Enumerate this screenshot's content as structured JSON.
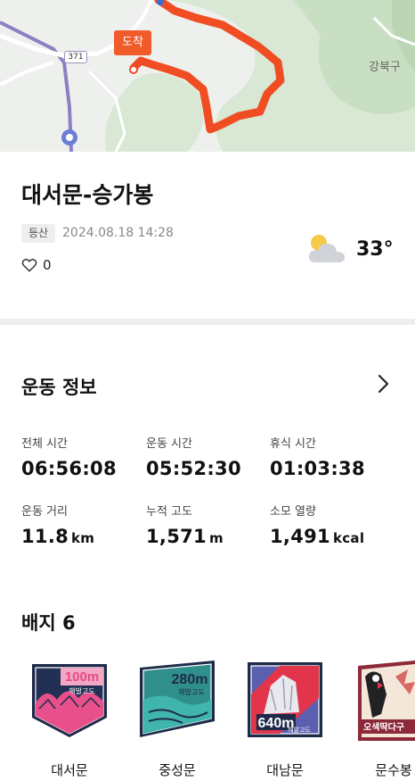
{
  "map": {
    "arrival_label": "도착",
    "route_number": "371",
    "district_label": "강북구",
    "route_color": "#f04d23"
  },
  "record": {
    "title": "대서문-승가봉",
    "category_tag": "등산",
    "datetime": "2024.08.18 14:28",
    "like_count": "0",
    "weather_icon": "partly-cloudy-icon",
    "temperature": "33°"
  },
  "exercise": {
    "section_title": "운동 정보",
    "stats": [
      {
        "label": "전체 시간",
        "value": "06:56:08",
        "unit": ""
      },
      {
        "label": "운동 시간",
        "value": "05:52:30",
        "unit": ""
      },
      {
        "label": "휴식 시간",
        "value": "01:03:38",
        "unit": ""
      },
      {
        "label": "운동 거리",
        "value": "11.8",
        "unit": "km"
      },
      {
        "label": "누적 고도",
        "value": "1,571",
        "unit": "m"
      },
      {
        "label": "소모 열량",
        "value": "1,491",
        "unit": "kcal"
      }
    ]
  },
  "badges": {
    "section_title": "배지 6",
    "items": [
      {
        "name": "대서문",
        "altitude": "100m",
        "caption": "해발고도"
      },
      {
        "name": "중성문",
        "altitude": "280m",
        "caption": "해발고도"
      },
      {
        "name": "대남문",
        "altitude": "640m",
        "caption": "해발고도"
      },
      {
        "name": "문수봉",
        "altitude": "",
        "caption": "오색딱다구"
      }
    ]
  }
}
